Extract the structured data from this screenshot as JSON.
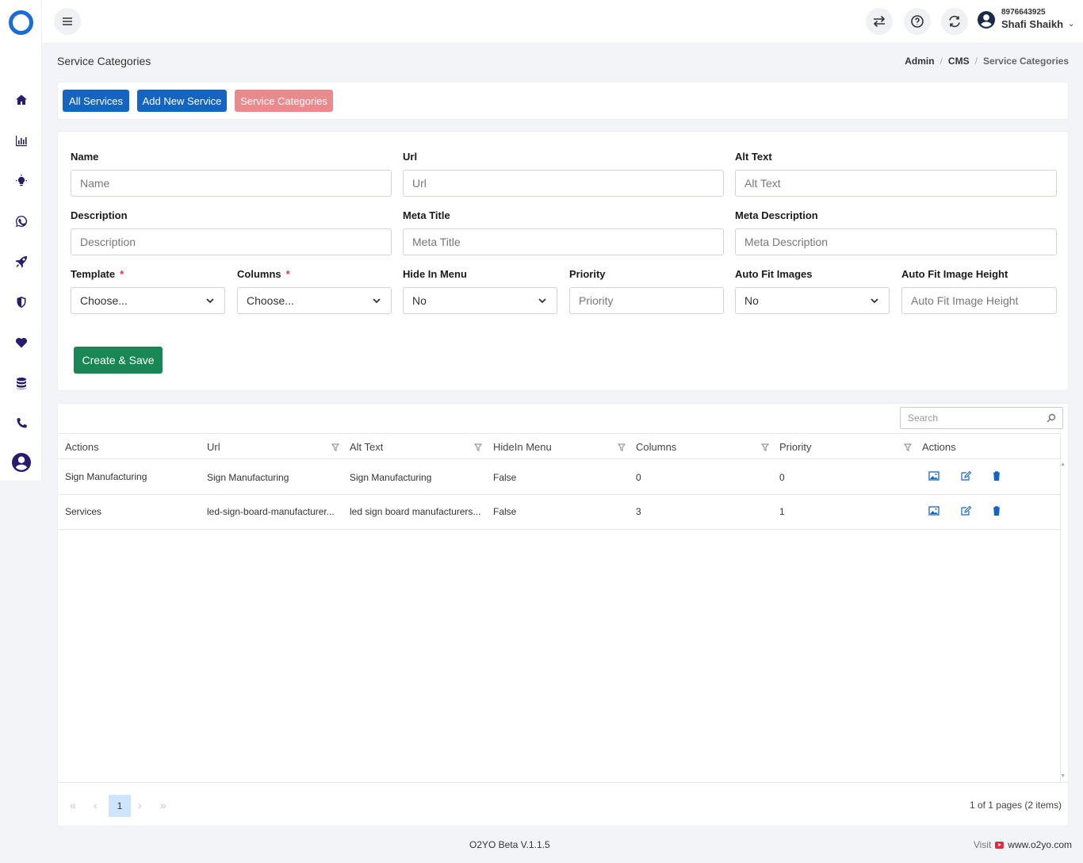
{
  "header": {
    "user_phone": "8976643925",
    "user_name": "Shafi Shaikh"
  },
  "page": {
    "title": "Service Categories",
    "breadcrumb": [
      "Admin",
      "CMS",
      "Service Categories"
    ]
  },
  "tabs": {
    "all_services": "All Services",
    "add_new_service": "Add New Service",
    "service_categories": "Service Categories"
  },
  "form": {
    "name": {
      "label": "Name",
      "placeholder": "Name"
    },
    "url": {
      "label": "Url",
      "placeholder": "Url"
    },
    "alt_text": {
      "label": "Alt Text",
      "placeholder": "Alt Text"
    },
    "description": {
      "label": "Description",
      "placeholder": "Description"
    },
    "meta_title": {
      "label": "Meta Title",
      "placeholder": "Meta Title"
    },
    "meta_description": {
      "label": "Meta Description",
      "placeholder": "Meta Description"
    },
    "template": {
      "label": "Template",
      "required": "*",
      "value": "Choose..."
    },
    "columns": {
      "label": "Columns",
      "required": "*",
      "value": "Choose..."
    },
    "hide_in_menu": {
      "label": "Hide In Menu",
      "value": "No"
    },
    "priority": {
      "label": "Priority",
      "placeholder": "Priority"
    },
    "auto_fit_images": {
      "label": "Auto Fit Images",
      "value": "No"
    },
    "auto_fit_image_height": {
      "label": "Auto Fit Image Height",
      "placeholder": "Auto Fit Image Height"
    },
    "submit": "Create & Save"
  },
  "grid": {
    "search_placeholder": "Search",
    "columns": [
      "Actions",
      "Url",
      "Alt Text",
      "HideIn Menu",
      "Columns",
      "Priority",
      "Actions"
    ],
    "rows": [
      {
        "name": "Sign Manufacturing",
        "url": "Sign Manufacturing",
        "alt": "Sign Manufacturing",
        "hide": "False",
        "columns": "0",
        "priority": "0"
      },
      {
        "name": "Services",
        "url": "led-sign-board-manufacturer...",
        "alt": "led sign board manufacturers...",
        "hide": "False",
        "columns": "3",
        "priority": "1"
      }
    ],
    "pager": {
      "current": "1",
      "info": "1 of 1 pages (2 items)"
    }
  },
  "footer": {
    "version": "O2YO Beta V.1.1.5",
    "visit": "Visit",
    "site": "www.o2yo.com"
  },
  "colors": {
    "primary": "#1565c0",
    "pink": "#e88a8e",
    "success": "#198754",
    "sidebar_icon": "#2b1b6e"
  }
}
